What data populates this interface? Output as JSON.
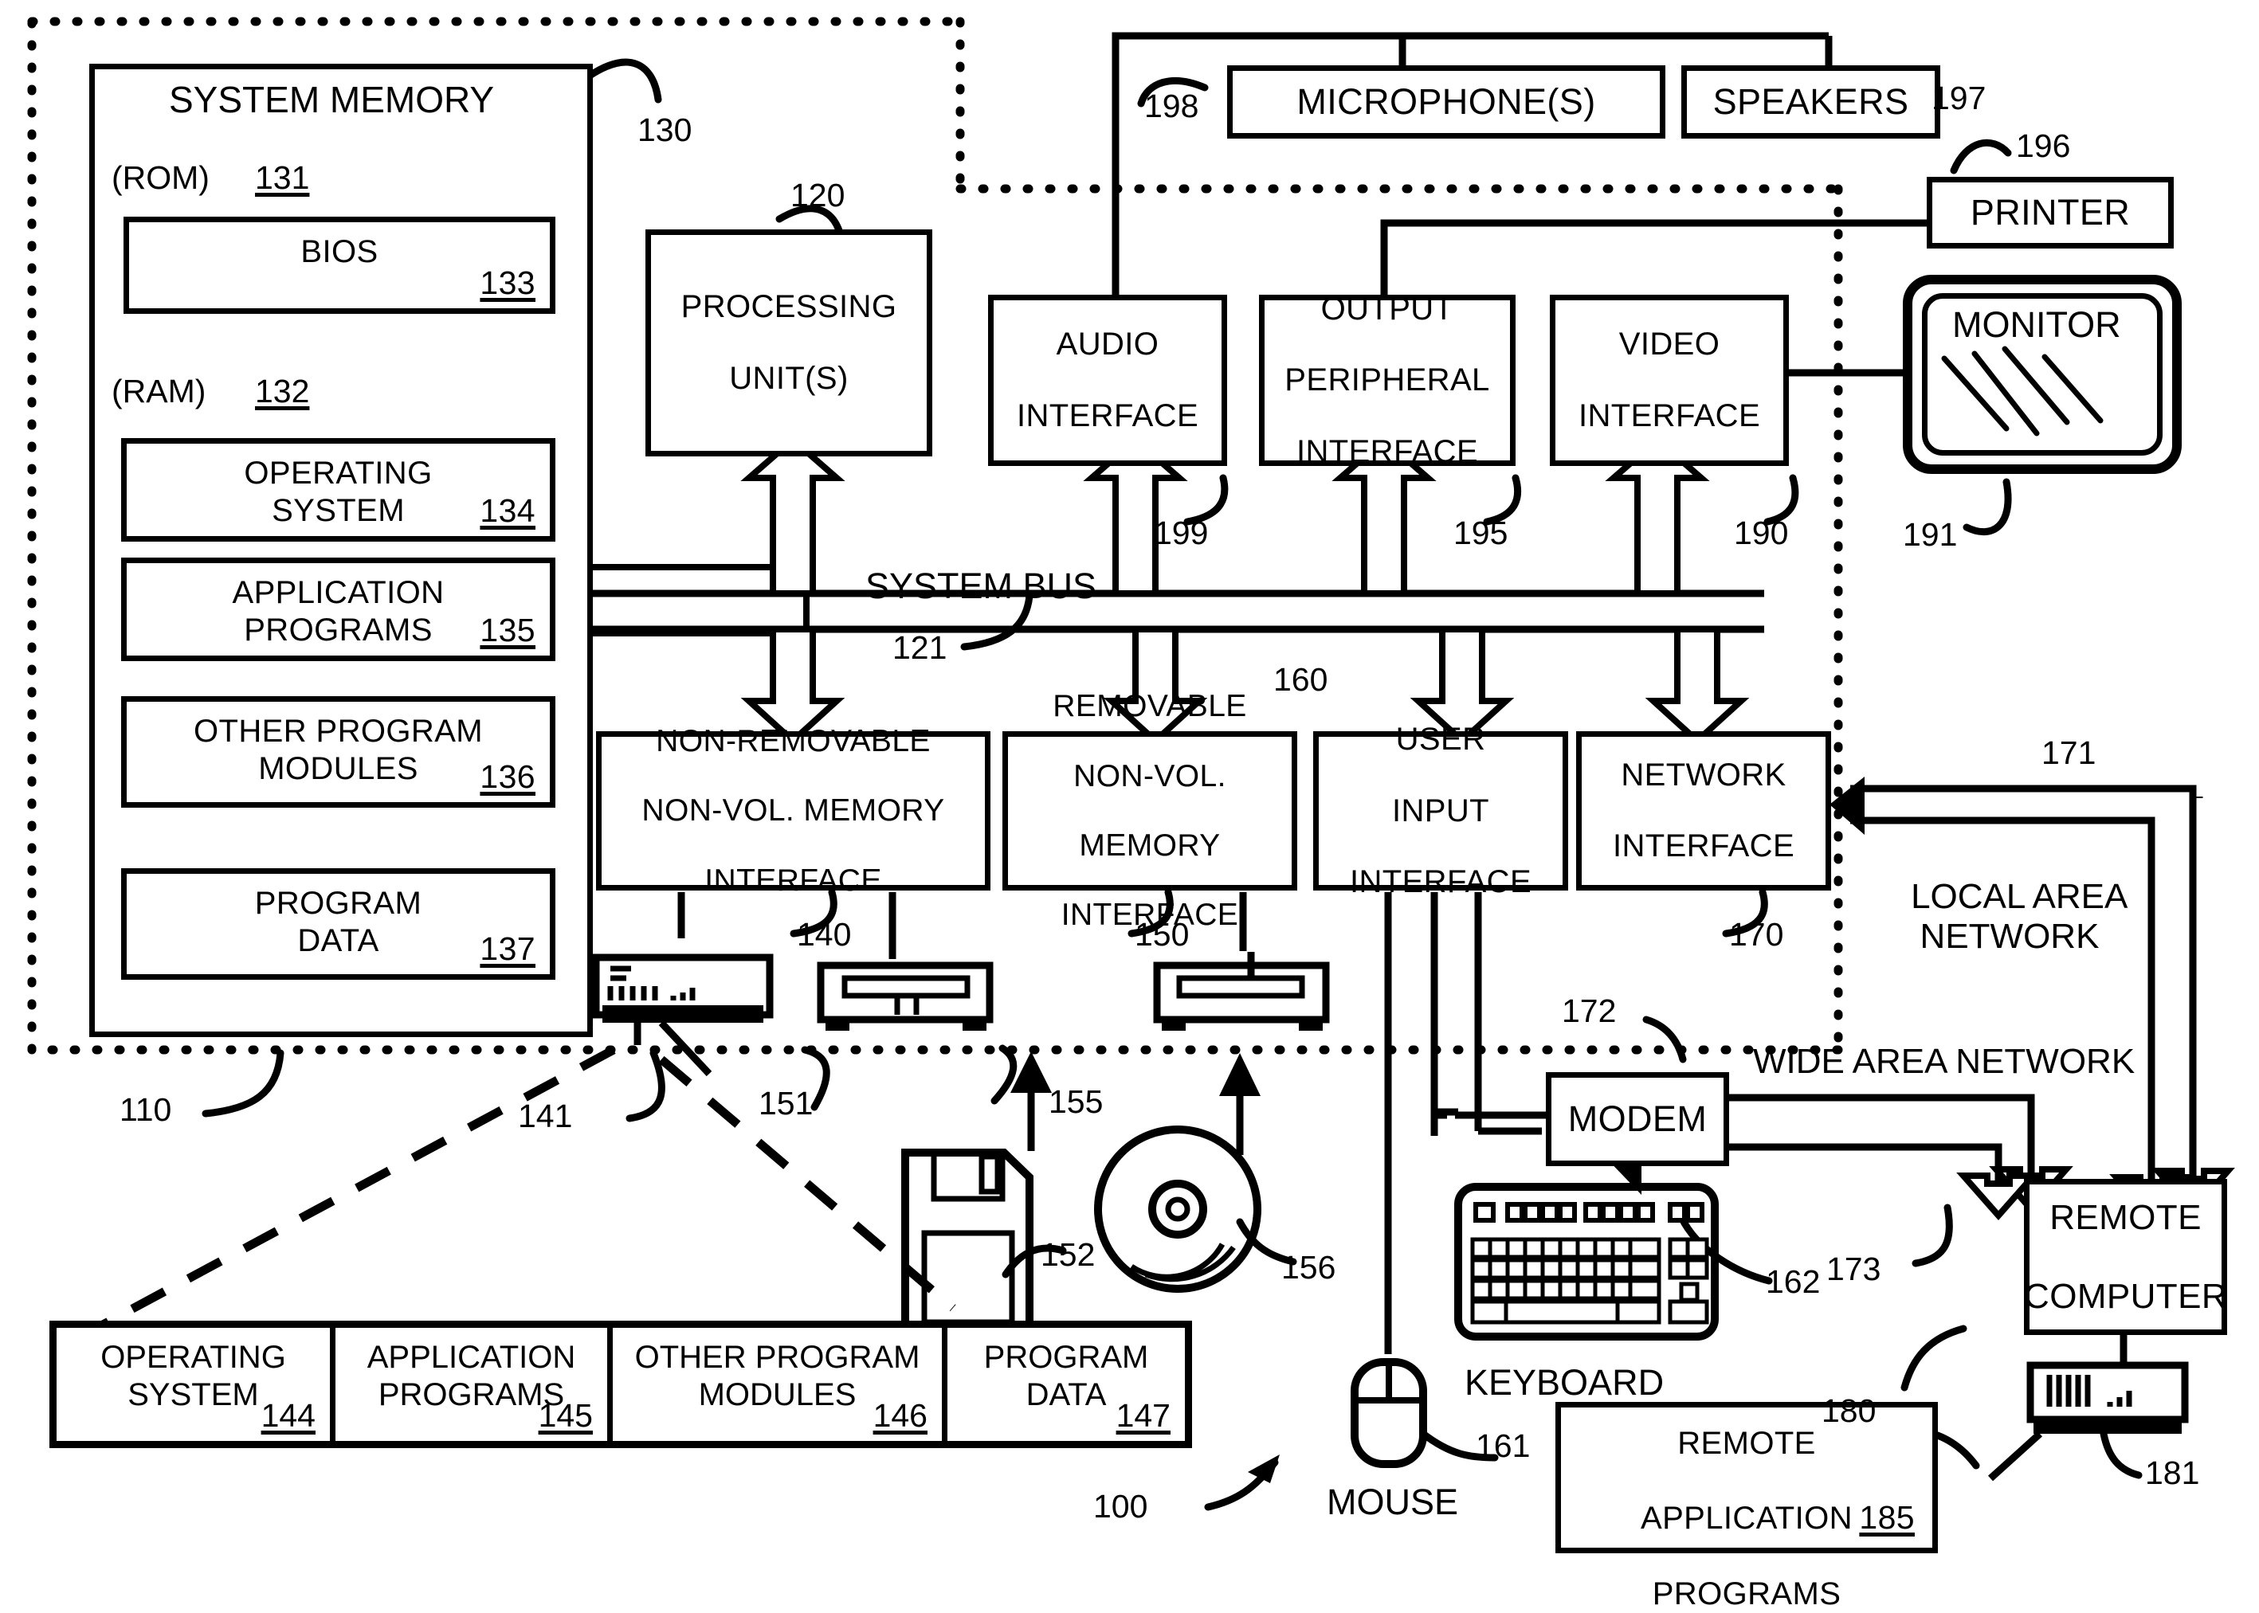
{
  "figure": {
    "ref_100": "100",
    "ref_110": "110",
    "ref_121": "121",
    "ref_130": "130",
    "ref_141": "141",
    "ref_151": "151",
    "ref_155": "155",
    "ref_152": "152",
    "ref_156": "156",
    "ref_160": "160",
    "ref_161": "161",
    "ref_162": "162",
    "ref_171": "171",
    "ref_172": "172",
    "ref_173": "173",
    "ref_180": "180",
    "ref_181": "181",
    "ref_190": "190",
    "ref_191": "191",
    "ref_195": "195",
    "ref_196": "196",
    "ref_197": "197",
    "ref_198": "198",
    "ref_199": "199",
    "ref_120": "120",
    "ref_140": "140",
    "ref_150": "150",
    "ref_170": "170"
  },
  "system_memory": {
    "title": "SYSTEM MEMORY",
    "rom_label": "(ROM)",
    "rom_ref": "131",
    "bios_label": "BIOS",
    "bios_ref": "133",
    "ram_label": "(RAM)",
    "ram_ref": "132",
    "modules": [
      {
        "line1": "OPERATING",
        "line2": "SYSTEM",
        "ref": "134"
      },
      {
        "line1": "APPLICATION",
        "line2": "PROGRAMS",
        "ref": "135"
      },
      {
        "line1": "OTHER PROGRAM",
        "line2": "MODULES",
        "ref": "136"
      },
      {
        "line1": "PROGRAM",
        "line2": "DATA",
        "ref": "137"
      }
    ]
  },
  "processing": {
    "line1": "PROCESSING",
    "line2": "UNIT(S)",
    "ref": "120"
  },
  "bus": {
    "label": "SYSTEM BUS",
    "ref": "121"
  },
  "top_interfaces": [
    {
      "line1": "AUDIO",
      "line2": "INTERFACE",
      "line3": "",
      "ref": "199"
    },
    {
      "line1": "OUTPUT",
      "line2": "PERIPHERAL",
      "line3": "INTERFACE",
      "ref": "195"
    },
    {
      "line1": "VIDEO",
      "line2": "INTERFACE",
      "line3": "",
      "ref": "190"
    }
  ],
  "bottom_interfaces": [
    {
      "line1": "NON-REMOVABLE",
      "line2": "NON-VOL. MEMORY",
      "line3": "INTERFACE",
      "ref": "140"
    },
    {
      "line1": "REMOVABLE",
      "line2": "NON-VOL.",
      "line3": "MEMORY",
      "line4": "INTERFACE",
      "ref": "150"
    },
    {
      "line1": "USER",
      "line2": "INPUT",
      "line3": "INTERFACE",
      "ref": "160"
    },
    {
      "line1": "NETWORK",
      "line2": "INTERFACE",
      "line3": "",
      "ref": "170"
    }
  ],
  "peripherals": {
    "microphone": "MICROPHONE(S)",
    "speakers": "SPEAKERS",
    "printer": "PRINTER",
    "monitor": "MONITOR",
    "modem": "MODEM",
    "keyboard_caption": "KEYBOARD",
    "mouse_caption": "MOUSE"
  },
  "networks": {
    "lan_line1": "LOCAL AREA",
    "lan_line2": "NETWORK",
    "wan": "WIDE AREA NETWORK"
  },
  "remote": {
    "computer_line1": "REMOTE",
    "computer_line2": "COMPUTER",
    "apps_line1": "REMOTE",
    "apps_line2": "APPLICATION",
    "apps_line3": "PROGRAMS",
    "apps_ref": "185"
  },
  "storage_table": {
    "cells": [
      {
        "line1": "OPERATING",
        "line2": "SYSTEM",
        "ref": "144"
      },
      {
        "line1": "APPLICATION",
        "line2": "PROGRAMS",
        "ref": "145"
      },
      {
        "line1": "OTHER PROGRAM",
        "line2": "MODULES",
        "ref": "146"
      },
      {
        "line1": "PROGRAM",
        "line2": "DATA",
        "ref": "147"
      }
    ]
  },
  "colors": {
    "ink": "#000000",
    "paper": "#ffffff"
  }
}
